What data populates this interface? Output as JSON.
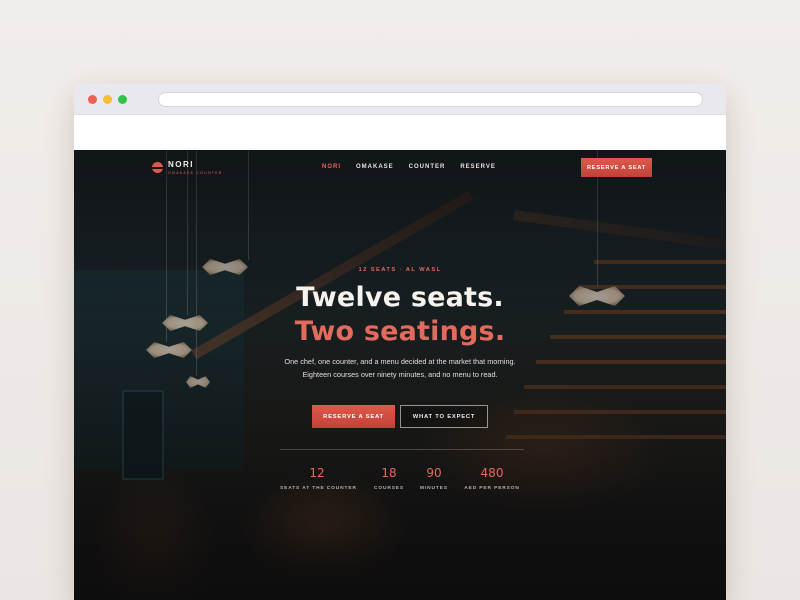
{
  "brand": {
    "name": "NORI",
    "tagline": "OMAKASE COUNTER"
  },
  "nav": {
    "links": [
      {
        "label": "NORI",
        "active": true
      },
      {
        "label": "OMAKASE",
        "active": false
      },
      {
        "label": "COUNTER",
        "active": false
      },
      {
        "label": "RESERVE",
        "active": false
      }
    ],
    "cta_label": "RESERVE A SEAT"
  },
  "hero": {
    "eyebrow": "12 SEATS · AL WASL",
    "headline_line1": "Twelve seats.",
    "headline_line2": "Two seatings.",
    "subtitle": "One chef, one counter, and a menu decided at the market that morning. Eighteen courses over ninety minutes, and no menu to read.",
    "primary_cta": "RESERVE A SEAT",
    "secondary_cta": "WHAT TO EXPECT"
  },
  "stats": [
    {
      "value": "12",
      "label": "SEATS AT THE COUNTER"
    },
    {
      "value": "18",
      "label": "COURSES"
    },
    {
      "value": "90",
      "label": "MINUTES"
    },
    {
      "value": "480",
      "label": "AED PER PERSON"
    }
  ],
  "colors": {
    "accent": "#e36b5d",
    "hero_bg": "#141212",
    "text_light": "#f6f2ee"
  }
}
